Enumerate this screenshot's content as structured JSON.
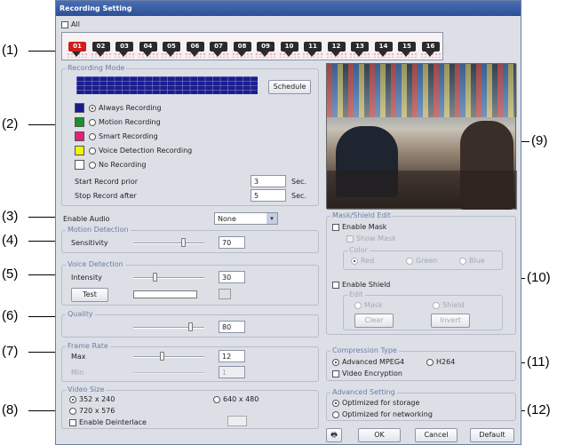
{
  "window": {
    "title": "Recording Setting"
  },
  "all_checkbox": "All",
  "cameras": [
    "01",
    "02",
    "03",
    "04",
    "05",
    "06",
    "07",
    "08",
    "09",
    "10",
    "11",
    "12",
    "13",
    "14",
    "15",
    "16"
  ],
  "recording_mode": {
    "legend": "Recording Mode",
    "schedule_button": "Schedule",
    "modes": [
      {
        "label": "Always Recording",
        "color": "#1a1a8c",
        "selected": true
      },
      {
        "label": "Motion Recording",
        "color": "#1f8f2a",
        "selected": false
      },
      {
        "label": "Smart Recording",
        "color": "#e0207a",
        "selected": false
      },
      {
        "label": "Voice Detection Recording",
        "color": "#f2f20a",
        "selected": false
      },
      {
        "label": "No Recording",
        "color": "#ffffff",
        "selected": false
      }
    ],
    "start_label": "Start Record prior",
    "start_value": "3",
    "stop_label": "Stop Record after",
    "stop_value": "5",
    "unit": "Sec."
  },
  "enable_audio": {
    "label": "Enable Audio",
    "value": "None"
  },
  "motion_detection": {
    "legend": "Motion Detection",
    "sensitivity_label": "Sensitivity",
    "value": "70",
    "level": 70
  },
  "voice_detection": {
    "legend": "Voice Detection",
    "intensity_label": "Intensity",
    "value": "30",
    "level": 30,
    "test_button": "Test"
  },
  "quality": {
    "legend": "Quality",
    "value": "80",
    "level": 80
  },
  "frame_rate": {
    "legend": "Frame Rate",
    "max_label": "Max",
    "max_value": "12",
    "min_label": "Min",
    "min_value": "1",
    "level": 40
  },
  "video_size": {
    "legend": "Video Size",
    "options": [
      "352 x 240",
      "640 x 480",
      "720 x 576"
    ],
    "selected": "352 x 240",
    "deinterlace": "Enable Deinterlace"
  },
  "mask_shield": {
    "legend": "Mask/Shield Edit",
    "enable_mask": "Enable Mask",
    "show_mask": "Show Mask",
    "color_legend": "Color",
    "colors": [
      "Red",
      "Green",
      "Blue"
    ],
    "enable_shield": "Enable Shield",
    "edit_legend": "Edit",
    "edit_options": [
      "Mask",
      "Shield"
    ],
    "clear_button": "Clear",
    "invert_button": "Invert"
  },
  "compression": {
    "legend": "Compression Type",
    "options": [
      "Advanced MPEG4",
      "H264"
    ],
    "encryption": "Video Encryption"
  },
  "advanced": {
    "legend": "Advanced Setting",
    "options": [
      "Optimized for storage",
      "Optimized for networking"
    ]
  },
  "buttons": {
    "ok": "OK",
    "cancel": "Cancel",
    "default": "Default"
  },
  "callouts": [
    "(1)",
    "(2)",
    "(3)",
    "(4)",
    "(5)",
    "(6)",
    "(7)",
    "(8)",
    "(9)",
    "(10)",
    "(11)",
    "(12)"
  ]
}
